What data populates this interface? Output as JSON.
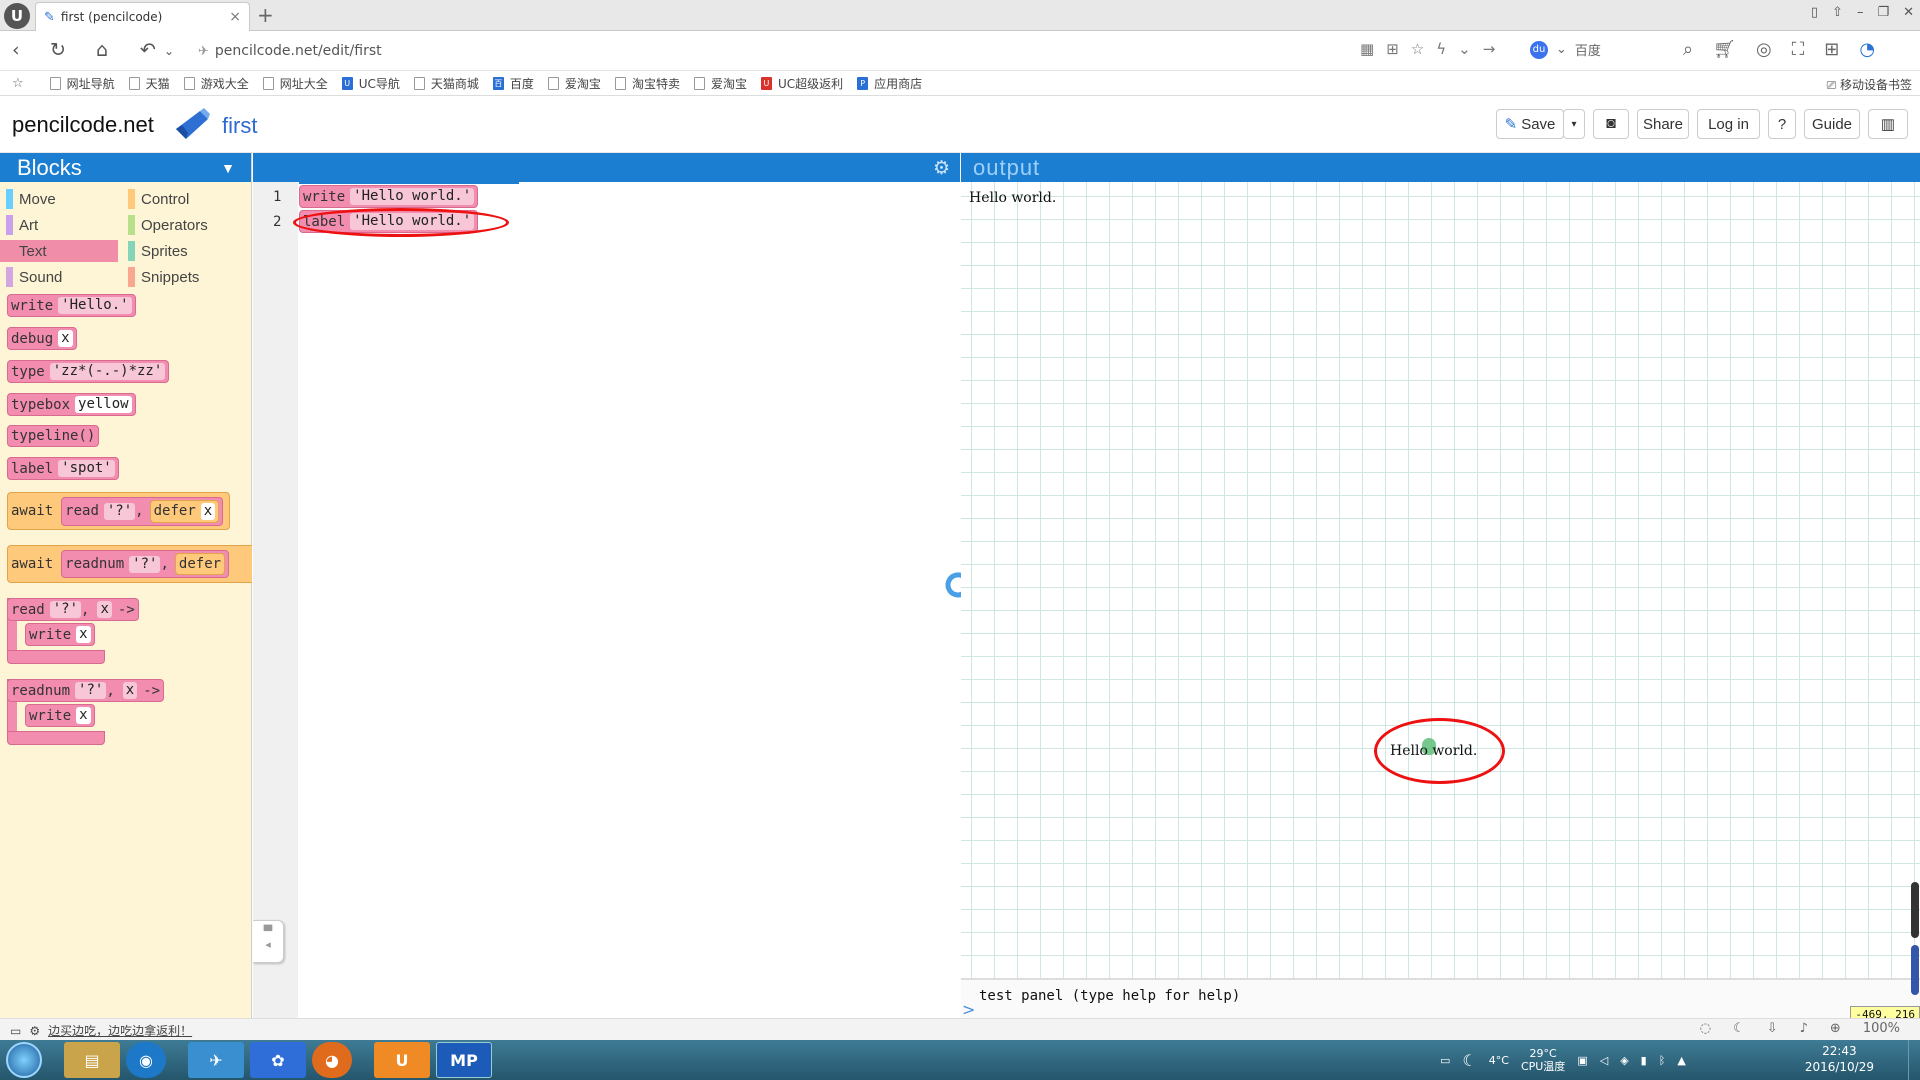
{
  "browser": {
    "logo_glyph": "U",
    "tab_title": "first (pencilcode)",
    "tab_close": "×",
    "new_tab": "+",
    "url": "pencilcode.net/edit/first",
    "search_engine_label": "百度",
    "window_controls": [
      "▯",
      "⇧",
      "–",
      "❐",
      "✕"
    ]
  },
  "bookmarks": [
    {
      "label": "网址导航",
      "icon": "page"
    },
    {
      "label": "天猫",
      "icon": "page"
    },
    {
      "label": "游戏大全",
      "icon": "page"
    },
    {
      "label": "网址大全",
      "icon": "page"
    },
    {
      "label": "UC导航",
      "icon": "uc"
    },
    {
      "label": "天猫商城",
      "icon": "page"
    },
    {
      "label": "百度",
      "icon": "baidu"
    },
    {
      "label": "爱淘宝",
      "icon": "page"
    },
    {
      "label": "淘宝特卖",
      "icon": "page"
    },
    {
      "label": "爱淘宝",
      "icon": "page"
    },
    {
      "label": "UC超级返利",
      "icon": "uc-red"
    },
    {
      "label": "应用商店",
      "icon": "store"
    }
  ],
  "mobile_bookmarks": "移动设备书签",
  "pc": {
    "site": "pencilcode.net",
    "filename": "first",
    "buttons": {
      "save": "Save",
      "share": "Share",
      "login": "Log in",
      "help": "?",
      "guide": "Guide"
    }
  },
  "palette": {
    "title": "Blocks",
    "categories": [
      {
        "label": "Move",
        "color": "#68cdff"
      },
      {
        "label": "Control",
        "color": "#ffc97b"
      },
      {
        "label": "Art",
        "color": "#c8a0ee"
      },
      {
        "label": "Operators",
        "color": "#b8e08a"
      },
      {
        "label": "Text",
        "color": "#f08eaa"
      },
      {
        "label": "Sprites",
        "color": "#85d4b8"
      },
      {
        "label": "Sound",
        "color": "#d2a6e0"
      },
      {
        "label": "Snippets",
        "color": "#f8a88e"
      }
    ],
    "blocks": {
      "write": {
        "kw": "write",
        "arg": "'Hello.'"
      },
      "debug": {
        "kw": "debug",
        "arg": "x"
      },
      "type": {
        "kw": "type",
        "arg": "'zz*(-.-)*zz'"
      },
      "typebox": {
        "kw": "typebox",
        "arg": "yellow"
      },
      "typeline": {
        "kw": "typeline()"
      },
      "label": {
        "kw": "label",
        "arg": "'spot'"
      },
      "await_read": {
        "kw": "await",
        "fn": "read",
        "arg": "'?'",
        "sep": ",",
        "defer": "defer",
        "x": "x"
      },
      "await_readnum": {
        "kw": "await",
        "fn": "readnum",
        "arg": "'?'",
        "sep": ",",
        "defer": "defer"
      },
      "read_cb": {
        "kw": "read",
        "arg": "'?'",
        "sep": ",",
        "param": "x",
        "arrow": "->",
        "inner_kw": "write",
        "inner_arg": "x"
      },
      "readnum_cb": {
        "kw": "readnum",
        "arg": "'?'",
        "sep": ",",
        "param": "x",
        "arrow": "->",
        "inner_kw": "write",
        "inner_arg": "x"
      }
    }
  },
  "editor": {
    "lines": [
      {
        "num": "1",
        "kw": "write",
        "arg": "'Hello world.'"
      },
      {
        "num": "2",
        "kw": "label",
        "arg": "'Hello world.'"
      }
    ]
  },
  "output": {
    "title": "output",
    "written_text": "Hello world.",
    "label_text": "Hello world.",
    "test_panel": "test panel (type help for help)",
    "prompt": ">",
    "coords": "-469, 216"
  },
  "statusbar": {
    "message": "边买边吃，边吃边拿返利！",
    "zoom": "100%"
  },
  "taskbar": {
    "apps": [
      "explorer",
      "browser",
      "mail",
      "baidu",
      "firefox",
      "uc",
      "MP"
    ],
    "weather": "4°C",
    "cpu_temp": "29°C",
    "cpu_label": "CPU温度",
    "time": "22:43",
    "date": "2016/10/29"
  },
  "colors": {
    "header_blue": "#1b7ed1",
    "block_pink": "#f28db0",
    "block_orange": "#ffc97b",
    "palette_bg": "#fdf5d5",
    "annotation_red": "#e11111"
  }
}
